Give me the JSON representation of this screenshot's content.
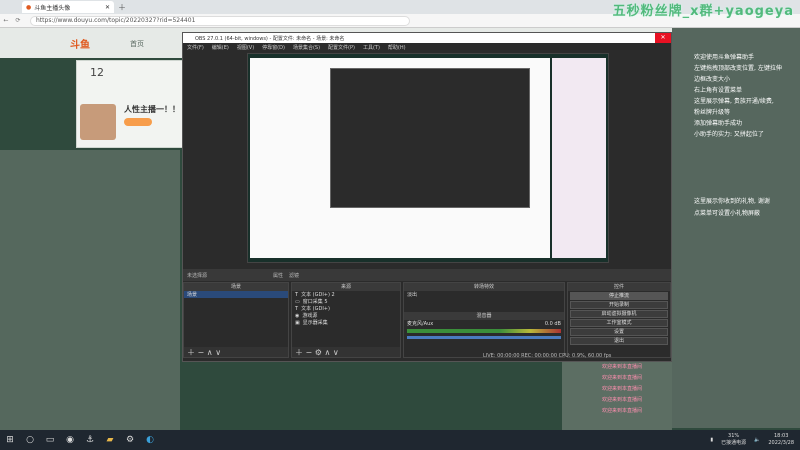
{
  "browser": {
    "tab_title": "斗鱼主播头像",
    "url": "https://www.douyu.com/topic/20220327?rid=524401"
  },
  "watermark": "五秒粉丝牌_x群+yaogeya",
  "douyu": {
    "logo": "斗鱼",
    "nav_home": "首页",
    "followers": "12",
    "streamer_name": "人性主播一！！"
  },
  "obs": {
    "title": "OBS 27.0.1 (64-bit, windows) - 配置文件: 未命名 - 场景: 未命名",
    "menu": [
      "文件(F)",
      "编辑(E)",
      "视图(V)",
      "停靠窗(D)",
      "场景集合(S)",
      "配置文件(P)",
      "工具(T)",
      "帮助(H)"
    ],
    "toolbar": [
      "未选择源",
      "属性",
      "滤镜"
    ],
    "docks": {
      "scenes": {
        "title": "场景",
        "items": [
          "场景"
        ]
      },
      "sources": {
        "title": "来源",
        "items": [
          "文本 (GDI+) 2",
          "窗口采集 5",
          "文本 (GDI+)",
          "游戏源",
          "显示器采集"
        ]
      },
      "transitions": {
        "title": "转场特效",
        "label": "淡出"
      },
      "mixer": {
        "title": "混音器",
        "track": "麦克风/Aux",
        "db": "0.0 dB"
      },
      "controls": {
        "title": "控件",
        "buttons": [
          "停止推流",
          "开始录制",
          "启动虚拟摄像机",
          "工作室模式",
          "设置",
          "退出"
        ]
      }
    },
    "status": "LIVE: 00:00:00   REC: 00:00:00   CPU: 0.9%, 60.00 fps"
  },
  "overlay_notes": [
    "欢迎使用斗鱼弹幕助手",
    "左键拖拽顶部改变位置, 左键拉伸",
    "边框改变大小",
    "右上角有设置菜单",
    "这里展示弹幕, 贵族开通/续费,",
    "粉丝牌升级等",
    "添加弹幕助手成功",
    "小助手的实力: 又拼起位了"
  ],
  "overlay_notes2": [
    "这里展示你收到的礼物, 谢谢",
    "点菜单可设置小礼物屏蔽"
  ],
  "gift_lines": [
    "欢迎来到本直播间",
    "欢迎来到本直播间",
    "欢迎来到本直播间",
    "欢迎来到本直播间",
    "欢迎来到本直播间"
  ],
  "taskbar": {
    "battery": "31%",
    "battery_label": "已接通电源",
    "time": "18:03",
    "date": "2022/3/28"
  }
}
